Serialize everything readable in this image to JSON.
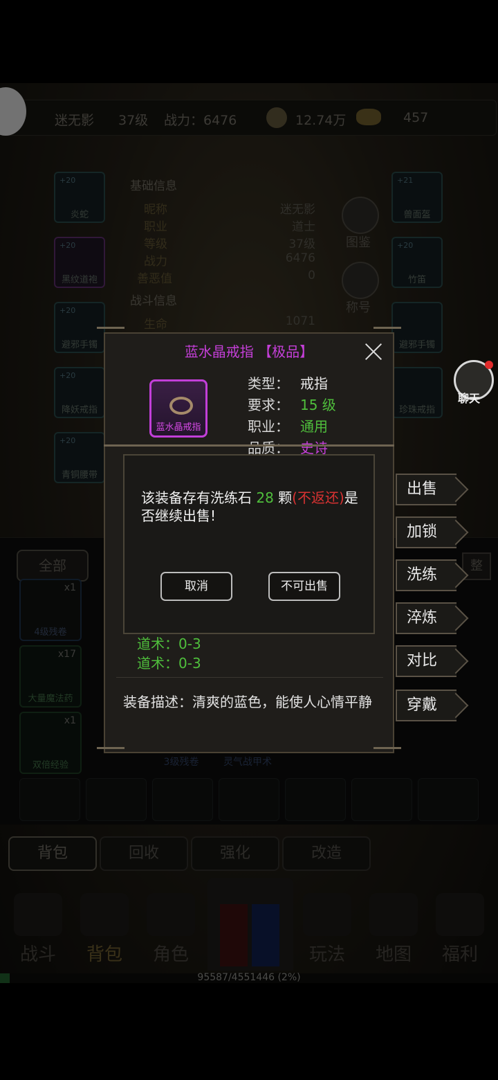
{
  "header": {
    "player_name": "迷无影",
    "level": "37级",
    "power": "战力：6476",
    "gold": "12.74万",
    "ingot": "457"
  },
  "left_slots": [
    {
      "plus": "+20",
      "name": "炎蛇"
    },
    {
      "plus": "+20",
      "name": "黑纹道袍"
    },
    {
      "plus": "+20",
      "name": "避邪手镯"
    },
    {
      "plus": "+20",
      "name": "降妖戒指"
    },
    {
      "plus": "+20",
      "name": "青铜腰带"
    }
  ],
  "right_slots": [
    {
      "plus": "+21",
      "name": "兽面盔"
    },
    {
      "plus": "+20",
      "name": "竹笛"
    },
    {
      "plus": "",
      "name": "避邪手镯"
    },
    {
      "plus": "+20",
      "name": "珍珠戒指"
    }
  ],
  "basic_info": {
    "title": "基础信息",
    "rows": [
      {
        "label": "昵称",
        "value": "迷无影"
      },
      {
        "label": "职业",
        "value": "道士"
      },
      {
        "label": "等级",
        "value": "37级"
      },
      {
        "label": "战力",
        "value": "6476"
      },
      {
        "label": "善恶值",
        "value": "0"
      }
    ],
    "combat_title": "战斗信息",
    "combat_row": {
      "label": "生命",
      "value": "1071"
    }
  },
  "side_icons": {
    "atlas": "图鉴",
    "title": "称号"
  },
  "bag": {
    "filter_all": "全部",
    "sort_btn": "整",
    "items": [
      {
        "name": "4级残卷",
        "count": "x1"
      },
      {
        "name": "大量魔法药",
        "count": "x17"
      },
      {
        "name": "双倍经验",
        "count": "x1"
      },
      {
        "name": "3级残卷",
        "count": ""
      },
      {
        "name": "灵气战甲术",
        "count": ""
      }
    ]
  },
  "sub_tabs": [
    "背包",
    "回收",
    "强化",
    "改造"
  ],
  "nav": [
    "战斗",
    "背包",
    "角色",
    "玩法",
    "地图",
    "福利"
  ],
  "exp_text": "95587/4551446 (2%)",
  "popup": {
    "title": "蓝水晶戒指 【极品】",
    "icon_name": "蓝水晶戒指",
    "type_label": "类型：",
    "type_value": "戒指",
    "req_label": "要求：",
    "req_value": "15 级",
    "job_label": "职业：",
    "job_value": "通用",
    "quality_label": "品质：",
    "quality_value": "史诗",
    "stats": [
      "道术：0-3",
      "道术：0-3"
    ],
    "desc": "装备描述：清爽的蓝色，能使人心情平静"
  },
  "actions": [
    "出售",
    "加锁",
    "洗练",
    "淬炼",
    "对比",
    "穿戴"
  ],
  "confirm": {
    "msg_pre": "该装备存有洗练石 ",
    "msg_num": "28",
    "msg_unit": " 颗",
    "msg_warn": "(不返还)",
    "msg_post": "是否继续出售!",
    "cancel": "取消",
    "no_sell": "不可出售"
  },
  "chat_label": "聊天"
}
